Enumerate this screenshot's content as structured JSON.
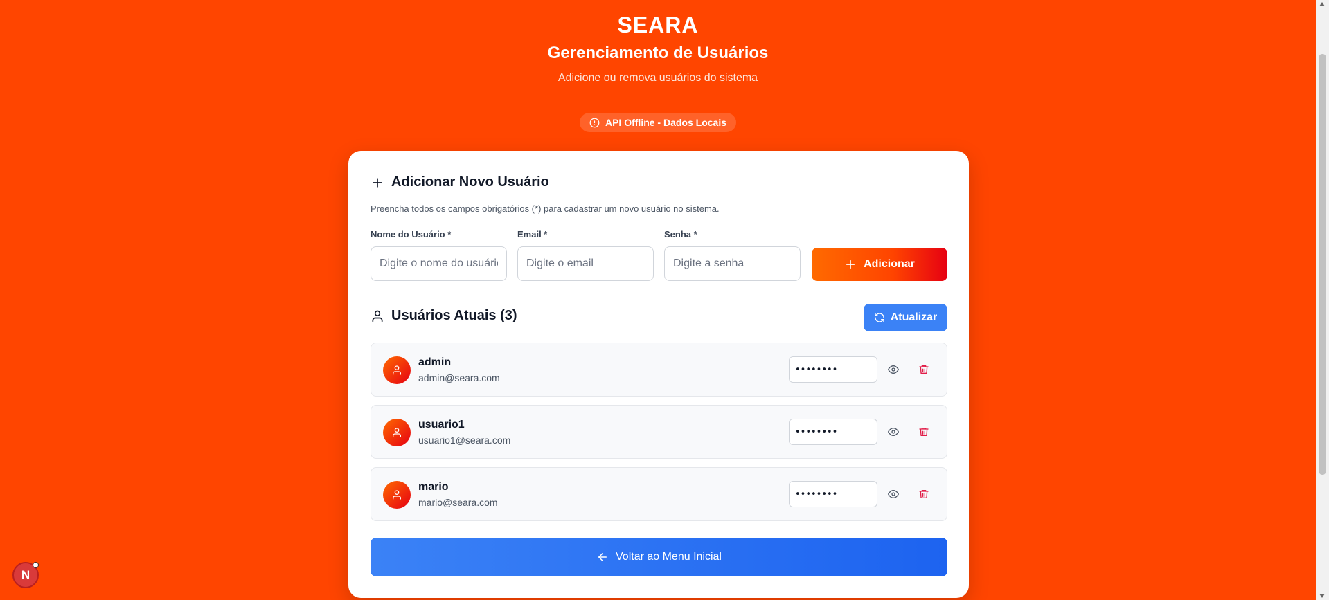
{
  "brand": "SEARA",
  "header": {
    "title": "Gerenciamento de Usuários",
    "subtitle": "Adicione ou remova usuários do sistema"
  },
  "status": {
    "label": "API Offline - Dados Locais",
    "icon": "alert-circle-icon"
  },
  "add_form": {
    "title": "Adicionar Novo Usuário",
    "description": "Preencha todos os campos obrigatórios (*) para cadastrar um novo usuário no sistema.",
    "name_label": "Nome do Usuário *",
    "name_placeholder": "Digite o nome do usuário",
    "email_label": "Email *",
    "email_placeholder": "Digite o email",
    "password_label": "Senha *",
    "password_placeholder": "Digite a senha",
    "submit_label": "Adicionar"
  },
  "users": {
    "title": "Usuários Atuais (3)",
    "refresh_label": "Atualizar",
    "items": [
      {
        "name": "admin",
        "email": "admin@seara.com",
        "password_mask": "••••••••"
      },
      {
        "name": "usuario1",
        "email": "usuario1@seara.com",
        "password_mask": "••••••••"
      },
      {
        "name": "mario",
        "email": "mario@seara.com",
        "password_mask": "••••••••"
      }
    ]
  },
  "back_label": "Voltar ao Menu Inicial",
  "dev_badge": "N",
  "colors": {
    "background": "#ff4500",
    "primary_blue": "#3b82f6",
    "danger_red": "#e11d48"
  }
}
